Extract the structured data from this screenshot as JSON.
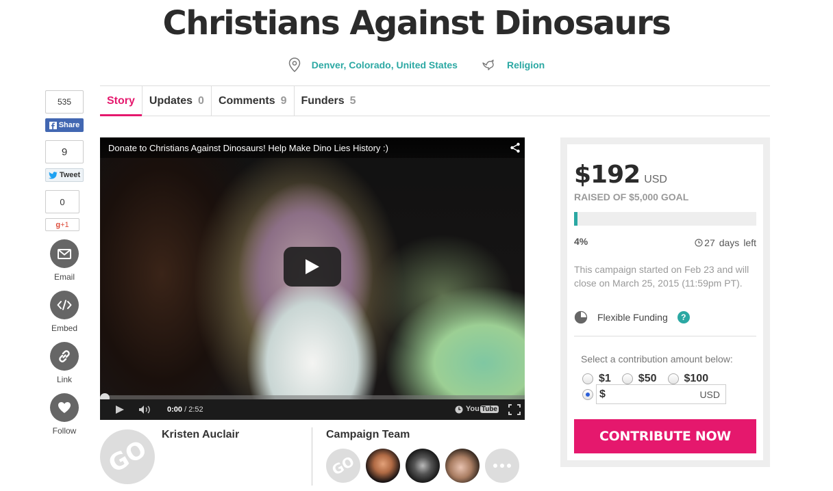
{
  "campaign": {
    "title": "Christians Against Dinosaurs",
    "location": "Denver, Colorado, United States",
    "category": "Religion"
  },
  "tabs": [
    {
      "label": "Story",
      "count": ""
    },
    {
      "label": "Updates",
      "count": "0"
    },
    {
      "label": "Comments",
      "count": "9"
    },
    {
      "label": "Funders",
      "count": "5"
    }
  ],
  "social": {
    "facebook_count": "535",
    "facebook_label": "Share",
    "twitter_count": "9",
    "twitter_label": "Tweet",
    "gplus_count": "0",
    "gplus_label": "+1",
    "gplus_g": "g",
    "email_label": "Email",
    "embed_label": "Embed",
    "link_label": "Link",
    "follow_label": "Follow"
  },
  "video": {
    "title": "Donate to Christians Against Dinosaurs! Help Make Dino Lies History :)",
    "current_time": "0:00",
    "duration": "/ 2:52",
    "logo_you": "You",
    "logo_tube": "Tube"
  },
  "author": {
    "name": "Kristen Auclair",
    "avatar_text": "GO"
  },
  "team": {
    "title": "Campaign Team",
    "first_avatar_text": "GO"
  },
  "funding": {
    "amount": "$192",
    "currency": "USD",
    "raised_text": "RAISED OF $5,000 GOAL",
    "progress_fraction": 0.02,
    "percent": "4%",
    "days_left": "27",
    "days_label": "days",
    "left_label": "left",
    "started_text": "This campaign started on Feb 23 and will close on March 25, 2015 (11:59pm PT).",
    "funding_type": "Flexible Funding",
    "help_label": "?",
    "select_label": "Select a contribution amount below:",
    "options": [
      "$1",
      "$50",
      "$100"
    ],
    "custom_dollar": "$",
    "custom_currency": "USD",
    "cta_label": "CONTRIBUTE NOW"
  },
  "colors": {
    "accent": "#e5186d",
    "teal": "#2ba8a3",
    "facebook": "#4267b2"
  }
}
